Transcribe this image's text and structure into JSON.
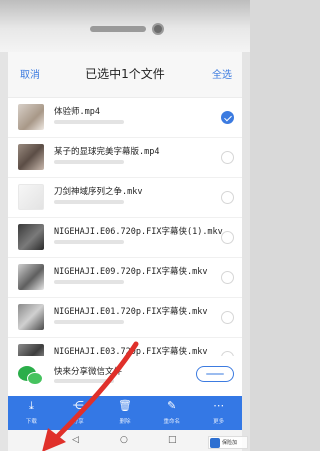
{
  "header": {
    "cancel": "取消",
    "title": "已选中1个文件",
    "select_all": "全选"
  },
  "files": [
    {
      "name": "体验师.mp4",
      "checked": true
    },
    {
      "name": "某子的显球完美字幕版.mp4",
      "checked": false
    },
    {
      "name": "刀剑神域序列之争.mkv",
      "checked": false
    },
    {
      "name": "NIGEHAJI.E06.720p.FIX字幕侠(1).mkv",
      "checked": false
    },
    {
      "name": "NIGEHAJI.E09.720p.FIX字幕侠.mkv",
      "checked": false
    },
    {
      "name": "NIGEHAJI.E01.720p.FIX字幕侠.mkv",
      "checked": false
    },
    {
      "name": "NIGEHAJI.E03.720p.FIX字幕侠.mkv",
      "checked": false
    }
  ],
  "wechat_row": {
    "label": "快来分享微信文件"
  },
  "toolbar": [
    {
      "label": "下载",
      "icon": "download-icon",
      "glyph": "⤓"
    },
    {
      "label": "分享",
      "icon": "share-icon",
      "glyph": "⋲"
    },
    {
      "label": "删除",
      "icon": "delete-icon",
      "glyph": "🗑"
    },
    {
      "label": "重命名",
      "icon": "rename-icon",
      "glyph": "✎"
    },
    {
      "label": "更多",
      "icon": "more-icon",
      "glyph": "⋯"
    }
  ],
  "nav": {
    "back": "◁",
    "home": "○",
    "recent": "□"
  },
  "watermark": {
    "text": "保险加"
  },
  "colors": {
    "accent": "#3478e5",
    "arrow": "#e0302a",
    "wechat": "#2bae4a"
  }
}
